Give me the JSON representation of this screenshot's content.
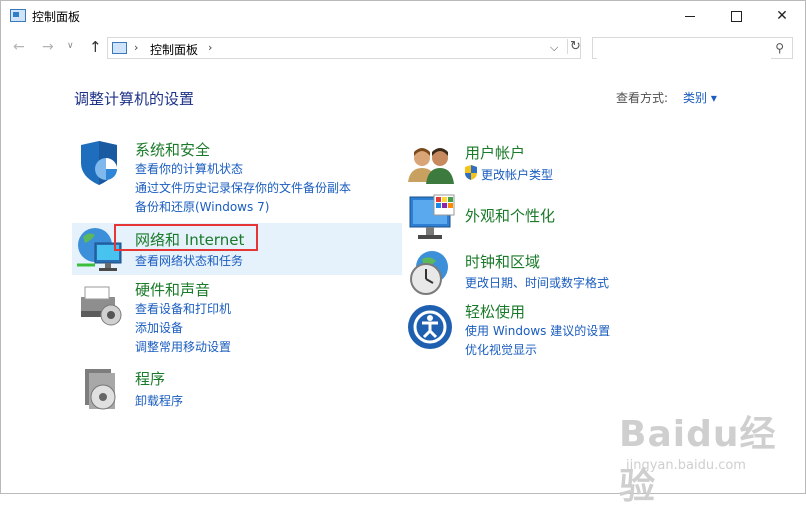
{
  "window": {
    "title": "控制面板"
  },
  "address": {
    "path_label": "控制面板",
    "separator": "›",
    "search_placeholder": ""
  },
  "header": {
    "heading": "调整计算机的设置",
    "view_label": "查看方式:",
    "view_value": "类别 ▾"
  },
  "categories": {
    "system": {
      "title": "系统和安全",
      "links": [
        "查看你的计算机状态",
        "通过文件历史记录保存你的文件备份副本",
        "备份和还原(Windows 7)"
      ]
    },
    "network": {
      "title": "网络和 Internet",
      "links": [
        "查看网络状态和任务"
      ]
    },
    "hardware": {
      "title": "硬件和声音",
      "links": [
        "查看设备和打印机",
        "添加设备",
        "调整常用移动设置"
      ]
    },
    "programs": {
      "title": "程序",
      "links": [
        "卸载程序"
      ]
    },
    "users": {
      "title": "用户帐户",
      "links": [
        "更改帐户类型"
      ]
    },
    "appearance": {
      "title": "外观和个性化",
      "links": []
    },
    "clock": {
      "title": "时钟和区域",
      "links": [
        "更改日期、时间或数字格式"
      ]
    },
    "ease": {
      "title": "轻松使用",
      "links": [
        "使用 Windows 建议的设置",
        "优化视觉显示"
      ]
    }
  },
  "watermark": {
    "logo": "Baidu经验",
    "url": "jingyan.baidu.com"
  },
  "colors": {
    "link": "#1a5dbf",
    "category_title": "#1a7a29",
    "heading": "#1e3287",
    "highlight": "#e5f1fb",
    "annotation_box": "#e53535"
  }
}
